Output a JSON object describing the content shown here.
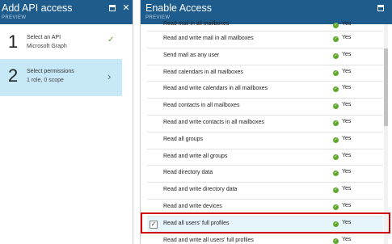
{
  "left_blade": {
    "title": "Add API access",
    "subtitle": "PREVIEW",
    "steps": [
      {
        "number": "1",
        "line1": "Select an API",
        "line2": "Microsoft Graph"
      },
      {
        "number": "2",
        "line1": "Select permissions",
        "line2": "1 role, 0 scope"
      }
    ]
  },
  "right_blade": {
    "title": "Enable Access",
    "subtitle": "PREVIEW",
    "permissions": [
      {
        "label": "Read mail in all mailboxes",
        "status": "Yes"
      },
      {
        "label": "Read and write mail in all mailboxes",
        "status": "Yes"
      },
      {
        "label": "Send mail as any user",
        "status": "Yes"
      },
      {
        "label": "Read calendars in all mailboxes",
        "status": "Yes"
      },
      {
        "label": "Read and write calendars in all mailboxes",
        "status": "Yes"
      },
      {
        "label": "Read contacts in all mailboxes",
        "status": "Yes"
      },
      {
        "label": "Read and write contacts in all mailboxes",
        "status": "Yes"
      },
      {
        "label": "Read all groups",
        "status": "Yes"
      },
      {
        "label": "Read and write all groups",
        "status": "Yes"
      },
      {
        "label": "Read directory data",
        "status": "Yes"
      },
      {
        "label": "Read and write directory data",
        "status": "Yes"
      },
      {
        "label": "Read and write devices",
        "status": "Yes"
      },
      {
        "label": "Read all users' full profiles",
        "status": "Yes",
        "checked": true
      },
      {
        "label": "Read and write all users' full profiles",
        "status": "Yes"
      }
    ]
  },
  "colors": {
    "header": "#1e5c8e",
    "selected_step": "#c7e9f7",
    "check": "#5ea92c",
    "highlight": "#d10000"
  },
  "icons": {
    "maximize": "maximize-icon",
    "close": "close-icon",
    "step_complete": "checkmark-icon",
    "step_next": "chevron-right-icon",
    "status": "check-circle-icon"
  }
}
